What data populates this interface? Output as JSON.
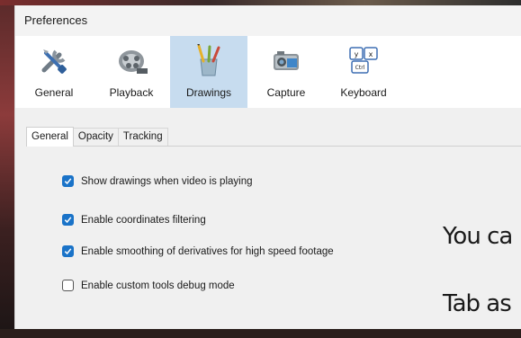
{
  "window": {
    "title": "Preferences"
  },
  "toolbar": {
    "items": [
      {
        "label": "General",
        "icon": "tools-icon"
      },
      {
        "label": "Playback",
        "icon": "film-reel-icon"
      },
      {
        "label": "Drawings",
        "icon": "brushes-icon",
        "active": true
      },
      {
        "label": "Capture",
        "icon": "camera-icon"
      },
      {
        "label": "Keyboard",
        "icon": "keyboard-keys-icon",
        "keys": [
          "y",
          "x",
          "Ctrl"
        ]
      }
    ]
  },
  "tabs": [
    {
      "label": "General",
      "active": true
    },
    {
      "label": "Opacity"
    },
    {
      "label": "Tracking"
    }
  ],
  "options": [
    {
      "label": "Show drawings when video is playing",
      "checked": true
    },
    {
      "label": "Enable coordinates filtering",
      "checked": true
    },
    {
      "label": "Enable smoothing of derivatives for high speed footage",
      "checked": true
    },
    {
      "label": "Enable custom tools debug mode",
      "checked": false
    }
  ],
  "overlay": {
    "line1": "You ca",
    "line2": "Tab as"
  },
  "colors": {
    "accent": "#1a73c8",
    "selected_tool_bg": "#c7dcef"
  }
}
